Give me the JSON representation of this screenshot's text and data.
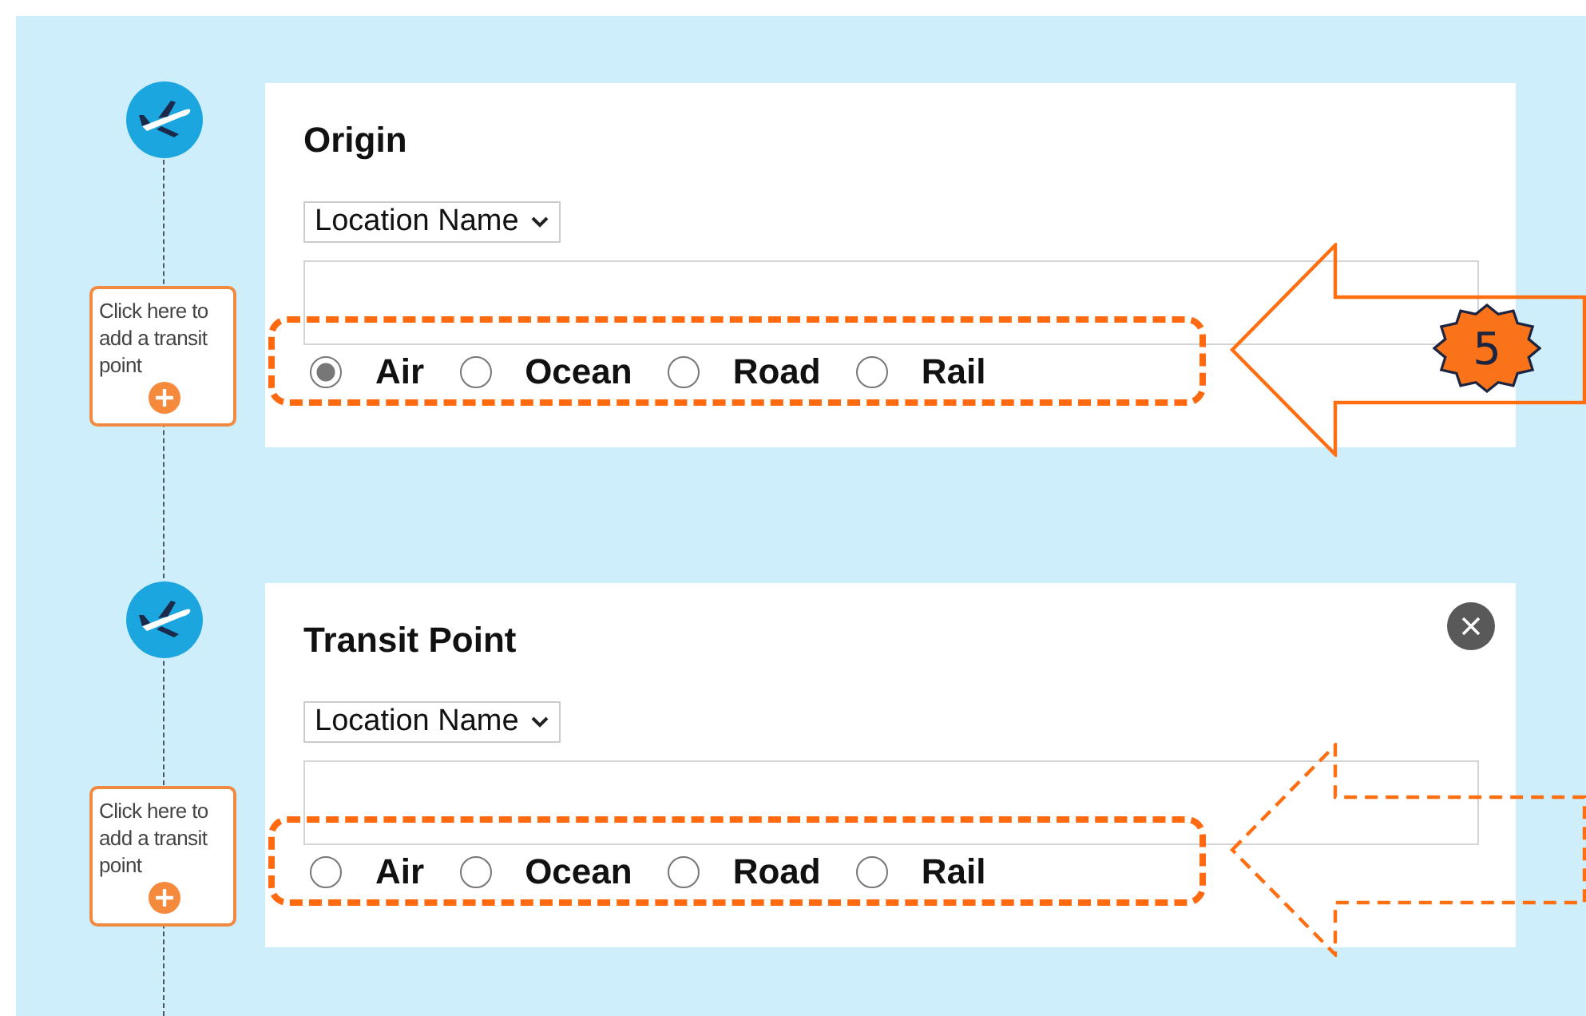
{
  "steps": [
    {
      "kind": "origin",
      "title": "Origin",
      "location_type": "Location Name",
      "modes": [
        {
          "label": "Air",
          "selected": true
        },
        {
          "label": "Ocean",
          "selected": false
        },
        {
          "label": "Road",
          "selected": false
        },
        {
          "label": "Rail",
          "selected": false
        }
      ],
      "add_point": "Click here to add a transit point",
      "callout": {
        "badge": "5"
      }
    },
    {
      "kind": "transit",
      "title": "Transit Point",
      "location_type": "Location Name",
      "modes": [
        {
          "label": "Air",
          "selected": false
        },
        {
          "label": "Ocean",
          "selected": false
        },
        {
          "label": "Road",
          "selected": false
        },
        {
          "label": "Rail",
          "selected": false
        }
      ],
      "add_point": "Click here to add a transit point"
    }
  ]
}
